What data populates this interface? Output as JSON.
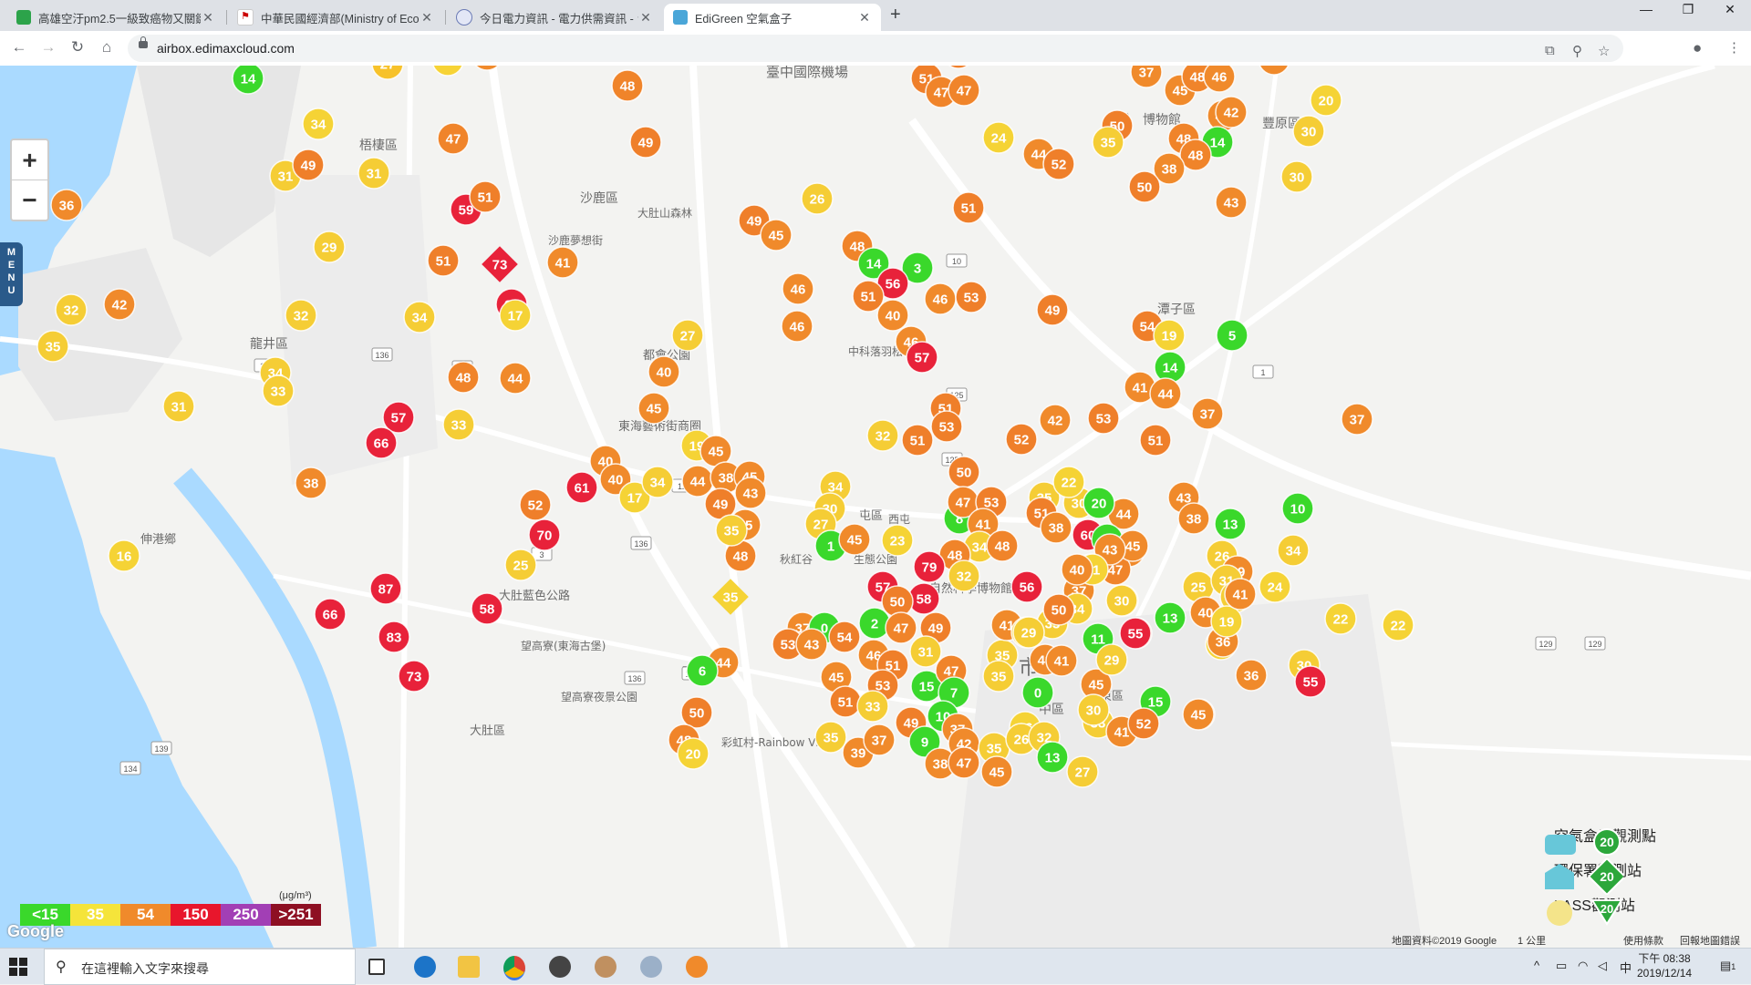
{
  "browser": {
    "tabs": [
      {
        "title": "高雄空汙pm2.5一級致癌物又關鍵",
        "active": false
      },
      {
        "title": "中華民國經濟部(Ministry of Econ",
        "active": false
      },
      {
        "title": "今日電力資訊 - 電力供需資訊 - 台",
        "active": false
      },
      {
        "title": "EdiGreen 空氣盒子",
        "active": true
      }
    ],
    "new_tab": "+",
    "url": "airbox.edimaxcloud.com"
  },
  "map": {
    "zoom_in": "+",
    "zoom_out": "−",
    "menu_label": "MENU",
    "place_labels": [
      {
        "text": "臺中國際機場"
      },
      {
        "text": "梧棲區"
      },
      {
        "text": "沙鹿區"
      },
      {
        "text": "大肚山森林"
      },
      {
        "text": "沙鹿夢想街"
      },
      {
        "text": "龍井區"
      },
      {
        "text": "都會公園"
      },
      {
        "text": "中科落羽松"
      },
      {
        "text": "東海藝術街商圈"
      },
      {
        "text": "伸港鄉"
      },
      {
        "text": "大肚藍色公路"
      },
      {
        "text": "望高寮(東海古堡)"
      },
      {
        "text": "望高寮夜景公園"
      },
      {
        "text": "大肚區"
      },
      {
        "text": "彩虹村-Rainbow Village"
      },
      {
        "text": "南屯"
      },
      {
        "text": "中區"
      },
      {
        "text": "北區"
      },
      {
        "text": "市"
      },
      {
        "text": "東區"
      },
      {
        "text": "潭子區"
      },
      {
        "text": "豐原區"
      },
      {
        "text": "台灣"
      },
      {
        "text": "博物館"
      },
      {
        "text": "秋紅谷"
      },
      {
        "text": "生態公園"
      },
      {
        "text": "自然科學博物館"
      },
      {
        "text": "屯區"
      },
      {
        "text": "西屯"
      }
    ],
    "road_labels": [
      "136",
      "136",
      "136",
      "136",
      "136",
      "125",
      "125",
      "129",
      "129",
      "139",
      "134",
      "12",
      "17",
      "3",
      "10",
      "1"
    ],
    "markers": [
      {
        "v": 14,
        "c": "#3ad82b"
      },
      {
        "v": 27,
        "c": "#f7c22a"
      },
      {
        "v": 24,
        "c": "#f7d335"
      },
      {
        "v": 39,
        "c": "#f08a2b"
      },
      {
        "v": 48,
        "c": "#f0842a"
      },
      {
        "v": 49,
        "c": "#ef7f2a"
      },
      {
        "v": 47,
        "c": "#f0842a"
      },
      {
        "v": 34,
        "c": "#f5d335"
      },
      {
        "v": 31,
        "c": "#f5cd35"
      },
      {
        "v": 49,
        "c": "#ef7f2a"
      },
      {
        "v": 31,
        "c": "#f5cd35"
      },
      {
        "v": 36,
        "c": "#f08a2b"
      },
      {
        "v": 59,
        "c": "#e8223a"
      },
      {
        "v": 51,
        "c": "#ef7f2a"
      },
      {
        "v": 29,
        "c": "#f5cd35"
      },
      {
        "v": 51,
        "c": "#ef7f2a"
      },
      {
        "v": 41,
        "c": "#f08a2b"
      },
      {
        "v": 64,
        "c": "#e8223a"
      },
      {
        "v": 17,
        "c": "#f5d335"
      },
      {
        "v": 32,
        "c": "#f5cd35"
      },
      {
        "v": 42,
        "c": "#f08a2b"
      },
      {
        "v": 35,
        "c": "#f5cd35"
      },
      {
        "v": 32,
        "c": "#f5cd35"
      },
      {
        "v": 34,
        "c": "#f5cd35"
      },
      {
        "v": 34,
        "c": "#f5cd35"
      },
      {
        "v": 33,
        "c": "#f5cd35"
      },
      {
        "v": 48,
        "c": "#f0842a"
      },
      {
        "v": 44,
        "c": "#f08a2b"
      },
      {
        "v": 31,
        "c": "#f5cd35"
      },
      {
        "v": 57,
        "c": "#e8223a"
      },
      {
        "v": 66,
        "c": "#e8223a"
      },
      {
        "v": 33,
        "c": "#f5cd35"
      },
      {
        "v": 38,
        "c": "#f08a2b"
      },
      {
        "v": 16,
        "c": "#f5d335"
      },
      {
        "v": 87,
        "c": "#e8223a"
      },
      {
        "v": 66,
        "c": "#e8223a"
      },
      {
        "v": 83,
        "c": "#e8223a"
      },
      {
        "v": 73,
        "c": "#e8223a"
      },
      {
        "v": 58,
        "c": "#e8223a"
      },
      {
        "v": 70,
        "c": "#e8223a"
      },
      {
        "v": 25,
        "c": "#f5cd35"
      },
      {
        "v": 52,
        "c": "#ef7f2a"
      },
      {
        "v": 61,
        "c": "#e8223a"
      },
      {
        "v": 40,
        "c": "#f08a2b"
      },
      {
        "v": 40,
        "c": "#f08a2b"
      },
      {
        "v": 17,
        "c": "#f5d335"
      },
      {
        "v": 34,
        "c": "#f5cd35"
      },
      {
        "v": 40,
        "c": "#f08a2b"
      },
      {
        "v": 45,
        "c": "#f08a2b"
      },
      {
        "v": 27,
        "c": "#f5cd35"
      },
      {
        "v": 19,
        "c": "#f5d335"
      },
      {
        "v": 45,
        "c": "#f08a2b"
      },
      {
        "v": 44,
        "c": "#f08a2b"
      },
      {
        "v": 38,
        "c": "#f08a2b"
      },
      {
        "v": 45,
        "c": "#f08a2b"
      },
      {
        "v": 43,
        "c": "#f08a2b"
      },
      {
        "v": 49,
        "c": "#ef7f2a"
      },
      {
        "v": 45,
        "c": "#f08a2b"
      },
      {
        "v": 48,
        "c": "#f0842a"
      },
      {
        "v": 35,
        "c": "#f5cd35"
      },
      {
        "v": 44,
        "c": "#f08a2b"
      },
      {
        "v": 6,
        "c": "#3ad82b"
      },
      {
        "v": 50,
        "c": "#ef7f2a"
      },
      {
        "v": 48,
        "c": "#f0842a"
      },
      {
        "v": 20,
        "c": "#f5d335"
      },
      {
        "v": 48,
        "c": "#f0842a"
      },
      {
        "v": 49,
        "c": "#ef7f2a"
      },
      {
        "v": 45,
        "c": "#f08a2b"
      },
      {
        "v": 26,
        "c": "#f5cd35"
      },
      {
        "v": 48,
        "c": "#f0842a"
      },
      {
        "v": 14,
        "c": "#3ad82b"
      },
      {
        "v": 3,
        "c": "#3ad82b"
      },
      {
        "v": 56,
        "c": "#e8223a"
      },
      {
        "v": 46,
        "c": "#f08a2b"
      },
      {
        "v": 51,
        "c": "#ef7f2a"
      },
      {
        "v": 46,
        "c": "#f08a2b"
      },
      {
        "v": 53,
        "c": "#ef7f2a"
      },
      {
        "v": 40,
        "c": "#f08a2b"
      },
      {
        "v": 46,
        "c": "#f08a2b"
      },
      {
        "v": 46,
        "c": "#f08a2b"
      },
      {
        "v": 57,
        "c": "#e8223a"
      },
      {
        "v": 51,
        "c": "#ef7f2a"
      },
      {
        "v": 44,
        "c": "#f08a2b"
      },
      {
        "v": 52,
        "c": "#ef7f2a"
      },
      {
        "v": 24,
        "c": "#f5d335"
      },
      {
        "v": 51,
        "c": "#ef7f2a"
      },
      {
        "v": 47,
        "c": "#f0842a"
      },
      {
        "v": 47,
        "c": "#f0842a"
      },
      {
        "v": 52,
        "c": "#ef7f2a"
      },
      {
        "v": 49,
        "c": "#ef7f2a"
      },
      {
        "v": 37,
        "c": "#f08a2b"
      },
      {
        "v": 45,
        "c": "#f08a2b"
      },
      {
        "v": 48,
        "c": "#f0842a"
      },
      {
        "v": 46,
        "c": "#f08a2b"
      },
      {
        "v": 41,
        "c": "#f08a2b"
      },
      {
        "v": 42,
        "c": "#f08a2b"
      },
      {
        "v": 37,
        "c": "#f08a2b"
      },
      {
        "v": 14,
        "c": "#3ad82b"
      },
      {
        "v": 50,
        "c": "#ef7f2a"
      },
      {
        "v": 35,
        "c": "#f5cd35"
      },
      {
        "v": 48,
        "c": "#f0842a"
      },
      {
        "v": 48,
        "c": "#f0842a"
      },
      {
        "v": 38,
        "c": "#f08a2b"
      },
      {
        "v": 50,
        "c": "#ef7f2a"
      },
      {
        "v": 43,
        "c": "#f08a2b"
      },
      {
        "v": 30,
        "c": "#f5cd35"
      },
      {
        "v": 30,
        "c": "#f5cd35"
      },
      {
        "v": 20,
        "c": "#f5d335"
      },
      {
        "v": 54,
        "c": "#ef7f2a"
      },
      {
        "v": 19,
        "c": "#f5d335"
      },
      {
        "v": 5,
        "c": "#3ad82b"
      },
      {
        "v": 14,
        "c": "#3ad82b"
      },
      {
        "v": 41,
        "c": "#f08a2b"
      },
      {
        "v": 44,
        "c": "#f08a2b"
      },
      {
        "v": 37,
        "c": "#f08a2b"
      },
      {
        "v": 37,
        "c": "#f08a2b"
      },
      {
        "v": 51,
        "c": "#ef7f2a"
      },
      {
        "v": 53,
        "c": "#ef7f2a"
      },
      {
        "v": 42,
        "c": "#f08a2b"
      },
      {
        "v": 52,
        "c": "#ef7f2a"
      },
      {
        "v": 51,
        "c": "#ef7f2a"
      },
      {
        "v": 53,
        "c": "#ef7f2a"
      },
      {
        "v": 32,
        "c": "#f5cd35"
      },
      {
        "v": 51,
        "c": "#ef7f2a"
      },
      {
        "v": 50,
        "c": "#ef7f2a"
      },
      {
        "v": 34,
        "c": "#f5cd35"
      },
      {
        "v": 30,
        "c": "#f5cd35"
      },
      {
        "v": 27,
        "c": "#f5cd35"
      },
      {
        "v": 1,
        "c": "#3ad82b"
      },
      {
        "v": 45,
        "c": "#f08a2b"
      },
      {
        "v": 23,
        "c": "#f5d335"
      },
      {
        "v": 8,
        "c": "#3ad82b"
      },
      {
        "v": 47,
        "c": "#f0842a"
      },
      {
        "v": 53,
        "c": "#ef7f2a"
      },
      {
        "v": 41,
        "c": "#f08a2b"
      },
      {
        "v": 34,
        "c": "#f5cd35"
      },
      {
        "v": 48,
        "c": "#f0842a"
      },
      {
        "v": 48,
        "c": "#f0842a"
      },
      {
        "v": 79,
        "c": "#e8223a"
      },
      {
        "v": 32,
        "c": "#f5cd35"
      },
      {
        "v": 57,
        "c": "#e8223a"
      },
      {
        "v": 58,
        "c": "#e8223a"
      },
      {
        "v": 50,
        "c": "#ef7f2a"
      },
      {
        "v": 56,
        "c": "#e8223a"
      },
      {
        "v": 35,
        "c": "#f5cd35"
      },
      {
        "v": 30,
        "c": "#f5cd35"
      },
      {
        "v": 46,
        "c": "#f08a2b"
      },
      {
        "v": 22,
        "c": "#f5d335"
      },
      {
        "v": 44,
        "c": "#f08a2b"
      },
      {
        "v": 60,
        "c": "#e8223a"
      },
      {
        "v": 11,
        "c": "#3ad82b"
      },
      {
        "v": 39,
        "c": "#f08a2b"
      },
      {
        "v": 44,
        "c": "#f08a2b"
      },
      {
        "v": 47,
        "c": "#f0842a"
      },
      {
        "v": 37,
        "c": "#f08a2b"
      },
      {
        "v": 34,
        "c": "#f5cd35"
      },
      {
        "v": 43,
        "c": "#f08a2b"
      },
      {
        "v": 38,
        "c": "#f08a2b"
      },
      {
        "v": 13,
        "c": "#3ad82b"
      },
      {
        "v": 26,
        "c": "#f5cd35"
      },
      {
        "v": 34,
        "c": "#f5cd35"
      },
      {
        "v": 10,
        "c": "#3ad82b"
      },
      {
        "v": 39,
        "c": "#f08a2b"
      },
      {
        "v": 25,
        "c": "#f5cd35"
      },
      {
        "v": 31,
        "c": "#f5cd35"
      },
      {
        "v": 32,
        "c": "#f5cd35"
      },
      {
        "v": 24,
        "c": "#f5d335"
      },
      {
        "v": 40,
        "c": "#f08a2b"
      },
      {
        "v": 13,
        "c": "#3ad82b"
      },
      {
        "v": 22,
        "c": "#f5d335"
      },
      {
        "v": 43,
        "c": "#f08a2b"
      },
      {
        "v": 19,
        "c": "#f5d335"
      },
      {
        "v": 51,
        "c": "#ef7f2a"
      },
      {
        "v": 30,
        "c": "#f5cd35"
      },
      {
        "v": 36,
        "c": "#f08a2b"
      },
      {
        "v": 37,
        "c": "#f08a2b"
      },
      {
        "v": 0,
        "c": "#3ad82b"
      },
      {
        "v": 54,
        "c": "#ef7f2a"
      },
      {
        "v": 53,
        "c": "#ef7f2a"
      },
      {
        "v": 43,
        "c": "#f08a2b"
      },
      {
        "v": 45,
        "c": "#f08a2b"
      },
      {
        "v": 2,
        "c": "#3ad82b"
      },
      {
        "v": 47,
        "c": "#f0842a"
      },
      {
        "v": 49,
        "c": "#ef7f2a"
      },
      {
        "v": 46,
        "c": "#f08a2b"
      },
      {
        "v": 51,
        "c": "#ef7f2a"
      },
      {
        "v": 31,
        "c": "#f5cd35"
      },
      {
        "v": 15,
        "c": "#3ad82b"
      },
      {
        "v": 53,
        "c": "#ef7f2a"
      },
      {
        "v": 47,
        "c": "#f0842a"
      },
      {
        "v": 7,
        "c": "#3ad82b"
      },
      {
        "v": 51,
        "c": "#ef7f2a"
      },
      {
        "v": 33,
        "c": "#f5cd35"
      },
      {
        "v": 49,
        "c": "#ef7f2a"
      },
      {
        "v": 10,
        "c": "#3ad82b"
      },
      {
        "v": 37,
        "c": "#f08a2b"
      },
      {
        "v": 9,
        "c": "#3ad82b"
      },
      {
        "v": 42,
        "c": "#f08a2b"
      },
      {
        "v": 35,
        "c": "#f5cd35"
      },
      {
        "v": 39,
        "c": "#f08a2b"
      },
      {
        "v": 37,
        "c": "#f08a2b"
      },
      {
        "v": 38,
        "c": "#f08a2b"
      },
      {
        "v": 47,
        "c": "#f0842a"
      },
      {
        "v": 35,
        "c": "#f5cd35"
      },
      {
        "v": 45,
        "c": "#f08a2b"
      },
      {
        "v": 16,
        "c": "#f5d335"
      },
      {
        "v": 26,
        "c": "#f5cd35"
      },
      {
        "v": 32,
        "c": "#f5cd35"
      },
      {
        "v": 13,
        "c": "#3ad82b"
      },
      {
        "v": 27,
        "c": "#f5cd35"
      },
      {
        "v": 33,
        "c": "#f5cd35"
      },
      {
        "v": 45,
        "c": "#f08a2b"
      },
      {
        "v": 15,
        "c": "#3ad82b"
      },
      {
        "v": 41,
        "c": "#f08a2b"
      },
      {
        "v": 41,
        "c": "#f08a2b"
      },
      {
        "v": 52,
        "c": "#ef7f2a"
      },
      {
        "v": 35,
        "c": "#f5cd35"
      },
      {
        "v": 35,
        "c": "#f5cd35"
      },
      {
        "v": 41,
        "c": "#f08a2b"
      },
      {
        "v": 35,
        "c": "#f5cd35"
      },
      {
        "v": 43,
        "c": "#f08a2b"
      },
      {
        "v": 41,
        "c": "#f08a2b"
      },
      {
        "v": 0,
        "c": "#3ad82b"
      },
      {
        "v": 11,
        "c": "#3ad82b"
      },
      {
        "v": 29,
        "c": "#f5cd35"
      },
      {
        "v": 55,
        "c": "#e8223a"
      },
      {
        "v": 33,
        "c": "#f5cd35"
      },
      {
        "v": 30,
        "c": "#f5cd35"
      },
      {
        "v": 29,
        "c": "#f5cd35"
      },
      {
        "v": 34,
        "c": "#f5cd35"
      },
      {
        "v": 45,
        "c": "#f08a2b"
      },
      {
        "v": 36,
        "c": "#f08a2b"
      },
      {
        "v": 19,
        "c": "#f5d335"
      },
      {
        "v": 41,
        "c": "#f08a2b"
      },
      {
        "v": 55,
        "c": "#e8223a"
      },
      {
        "v": 22,
        "c": "#f5d335"
      },
      {
        "v": 30,
        "c": "#f5cd35"
      },
      {
        "v": 45,
        "c": "#f08a2b"
      },
      {
        "v": 43,
        "c": "#f08a2b"
      },
      {
        "v": 21,
        "c": "#f5d335"
      },
      {
        "v": 20,
        "c": "#3ad82b"
      },
      {
        "v": 51,
        "c": "#ef7f2a"
      },
      {
        "v": 38,
        "c": "#f08a2b"
      },
      {
        "v": 40,
        "c": "#f08a2b"
      },
      {
        "v": 50,
        "c": "#ef7f2a"
      },
      {
        "v": 41,
        "c": "#f08a2b"
      },
      {
        "v": 53,
        "c": "#ef7f2a"
      },
      {
        "v": 59,
        "c": "#e8223a"
      },
      {
        "v": 44,
        "c": "#f08a2b"
      },
      {
        "v": 45,
        "c": "#f08a2b"
      },
      {
        "v": 38,
        "c": "#f08a2b"
      }
    ],
    "diamond_markers": [
      {
        "v": 73,
        "c": "#e8223a"
      },
      {
        "v": 35,
        "c": "#f5d335"
      }
    ],
    "legend": {
      "unit": "(μg/m³)",
      "items": [
        {
          "label": "<15",
          "color": "#3ad82b"
        },
        {
          "label": "35",
          "color": "#f5e43a"
        },
        {
          "label": "54",
          "color": "#f08a2b"
        },
        {
          "label": "150",
          "color": "#e8162c"
        },
        {
          "label": "250",
          "color": "#a23fb5"
        },
        {
          "label": ">251",
          "color": "#8e1023"
        }
      ]
    },
    "station_key": [
      {
        "label": "空氣盒子觀測點",
        "value": "20"
      },
      {
        "label": "環保署觀測站",
        "value": "20"
      },
      {
        "label": "LASS觀測站",
        "value": "20"
      }
    ],
    "google_logo": "Google",
    "attribution": "地圖資料©2019 Google",
    "scale": "1 公里",
    "terms": "使用條款",
    "report": "回報地圖錯誤"
  },
  "taskbar": {
    "search_placeholder": "在這裡輸入文字來搜尋",
    "time": "下午 08:38",
    "date": "2019/12/14",
    "ime": "中",
    "notif_count": "1"
  }
}
